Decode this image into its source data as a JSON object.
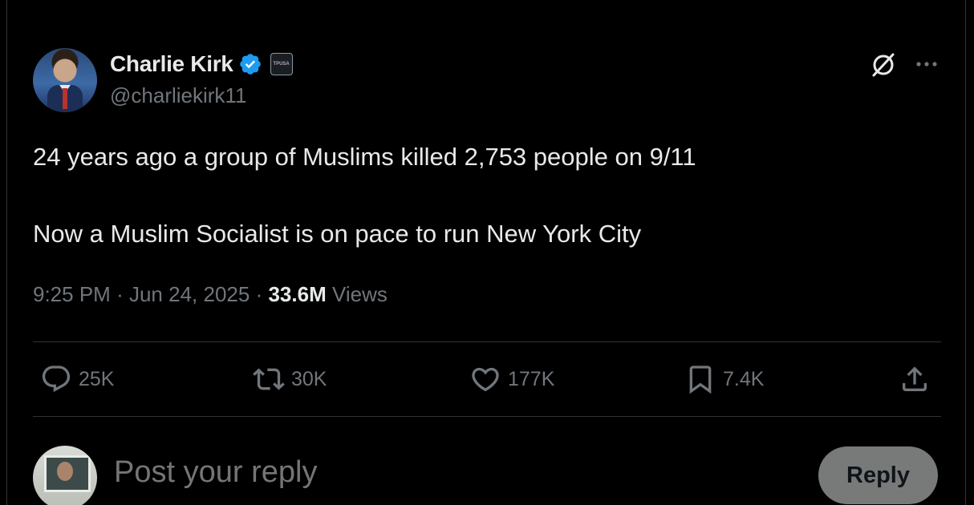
{
  "author": {
    "name": "Charlie Kirk",
    "handle": "@charliekirk11",
    "affiliation_badge_text": "TPUSA"
  },
  "tweet": {
    "line1": "24 years ago a group of Muslims killed 2,753 people on 9/11",
    "line2": "Now a Muslim Socialist is on pace to run New York City"
  },
  "meta": {
    "time": "9:25 PM",
    "separator": "·",
    "date": "Jun 24, 2025",
    "views_count": "33.6M",
    "views_label": "Views"
  },
  "actions": {
    "replies": "25K",
    "reposts": "30K",
    "likes": "177K",
    "bookmarks": "7.4K"
  },
  "reply_box": {
    "placeholder": "Post your reply",
    "button_label": "Reply"
  },
  "colors": {
    "background": "#000000",
    "text_primary": "#e7e9ea",
    "text_secondary": "#71767b",
    "verified_blue": "#1d9bf0",
    "divider": "#2f3336",
    "reply_button_bg": "#787a7a"
  },
  "icons": {
    "verified": "verified-badge-icon",
    "grok": "grok-icon",
    "more": "more-icon",
    "reply": "reply-icon",
    "repost": "repost-icon",
    "like": "heart-icon",
    "bookmark": "bookmark-icon",
    "share": "share-icon"
  }
}
